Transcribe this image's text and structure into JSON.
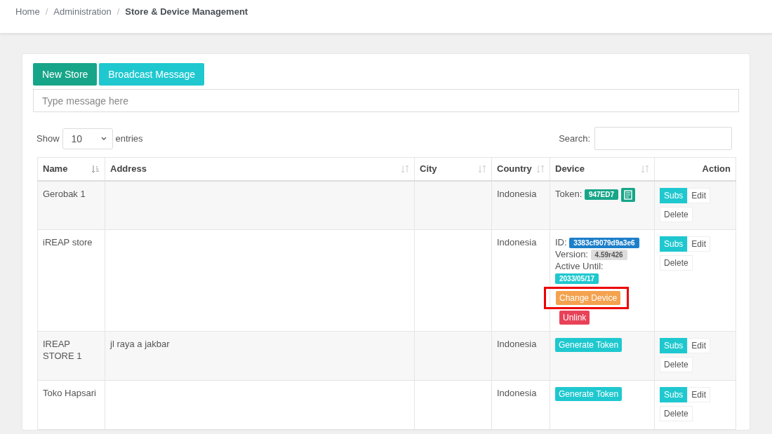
{
  "breadcrumb": [
    {
      "label": "Home",
      "current": false
    },
    {
      "label": "Administration",
      "current": false
    },
    {
      "label": "Store & Device Management",
      "current": true
    }
  ],
  "breadcrumb_separator": "/",
  "buttons": [
    {
      "label": "New Store",
      "kind": "primary"
    },
    {
      "label": "Broadcast Message",
      "kind": "info"
    }
  ],
  "message": {
    "placeholder": "Type message here"
  },
  "length": {
    "label_before": "Show",
    "value": "10",
    "label_after": "entries"
  },
  "search": {
    "label": "Search:"
  },
  "table": {
    "columns": [
      {
        "label": "Name",
        "kind": "sorted"
      },
      {
        "label": "Address",
        "kind": "sortable"
      },
      {
        "label": "City",
        "kind": "sortable"
      },
      {
        "label": "Country",
        "kind": "sortable"
      },
      {
        "label": "Device",
        "kind": "sortable"
      },
      {
        "label": "Action",
        "kind": "plain"
      }
    ],
    "rows": [
      {
        "name": "Gerobak 1",
        "address": "",
        "city": "",
        "country": "Indonesia",
        "device": {
          "kind": "token",
          "label": "Token:",
          "token": "947ED7"
        },
        "actions": [
          "Subs",
          "Edit",
          "Delete"
        ]
      },
      {
        "name": "iREAP store",
        "address": "",
        "city": "",
        "country": "Indonesia",
        "device": {
          "kind": "linked",
          "id_label": "ID:",
          "id": "3383cf9079d9a3e6",
          "version_label": "Version:",
          "version": "4.59r426",
          "active_label": "Active Until:",
          "active_until": "2033/05/17",
          "change_label": "Change Device",
          "unlink_label": "Unlink",
          "highlighted": true
        },
        "actions": [
          "Subs",
          "Edit",
          "Delete"
        ]
      },
      {
        "name": "IREAP STORE 1",
        "address": "jl raya a jakbar",
        "city": "",
        "country": "Indonesia",
        "device": {
          "kind": "generate",
          "label": "Generate Token"
        },
        "actions": [
          "Subs",
          "Edit",
          "Delete"
        ]
      },
      {
        "name": "Toko Hapsari",
        "address": "",
        "city": "",
        "country": "Indonesia",
        "device": {
          "kind": "generate",
          "label": "Generate Token"
        },
        "actions": [
          "Subs",
          "Edit",
          "Delete"
        ]
      }
    ]
  }
}
